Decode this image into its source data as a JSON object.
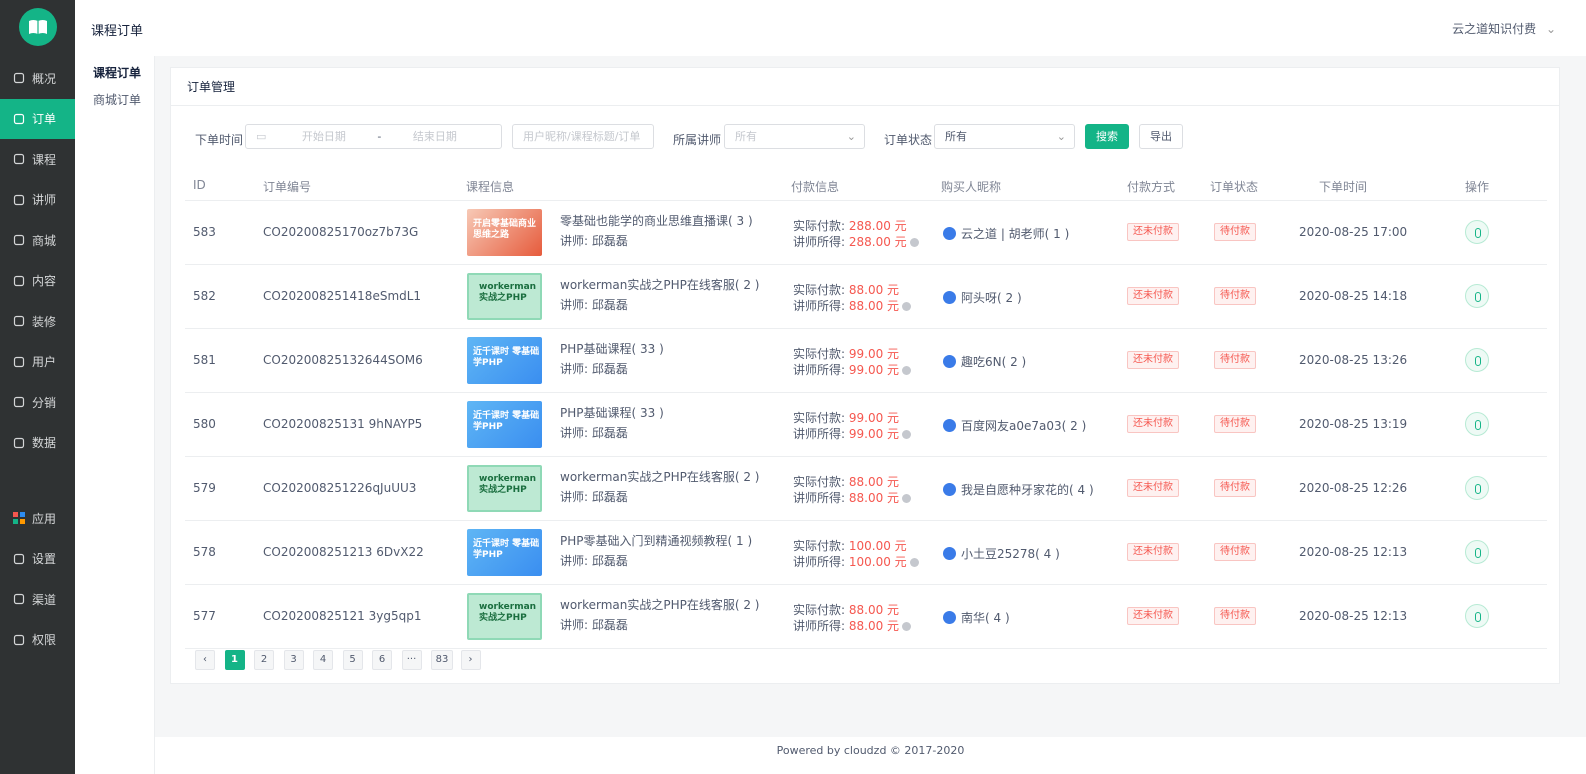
{
  "sidebar": {
    "items": [
      {
        "label": "概况",
        "icon": "home-icon"
      },
      {
        "label": "订单",
        "icon": "order-icon",
        "active": true
      },
      {
        "label": "课程",
        "icon": "course-icon"
      },
      {
        "label": "讲师",
        "icon": "teacher-icon"
      },
      {
        "label": "商城",
        "icon": "store-icon"
      },
      {
        "label": "内容",
        "icon": "content-icon"
      },
      {
        "label": "装修",
        "icon": "decorate-icon"
      },
      {
        "label": "用户",
        "icon": "user-icon"
      },
      {
        "label": "分销",
        "icon": "distribution-icon"
      },
      {
        "label": "数据",
        "icon": "data-icon"
      }
    ],
    "bottom_items": [
      {
        "label": "应用",
        "icon": "apps-icon"
      },
      {
        "label": "设置",
        "icon": "settings-icon"
      },
      {
        "label": "渠道",
        "icon": "channel-icon"
      },
      {
        "label": "权限",
        "icon": "permission-icon"
      }
    ]
  },
  "topbar": {
    "title": "课程订单",
    "user": "云之道知识付费"
  },
  "subnav": {
    "items": [
      "课程订单",
      "商城订单"
    ]
  },
  "card": {
    "title": "订单管理"
  },
  "filters": {
    "time_label": "下单时间",
    "start_placeholder": "开始日期",
    "range_sep": "-",
    "end_placeholder": "结束日期",
    "keyword_placeholder": "用户昵称/课程标题/订单",
    "teacher_label": "所属讲师",
    "teacher_value": "所有",
    "status_label": "订单状态",
    "status_value": "所有",
    "search_label": "搜索",
    "export_label": "导出"
  },
  "table": {
    "headers": [
      "ID",
      "订单编号",
      "课程信息",
      "付款信息",
      "购买人昵称",
      "付款方式",
      "订单状态",
      "下单时间",
      "操作"
    ],
    "paid_label": "实际付款:",
    "teacher_income_label": "讲师所得:",
    "teacher_prefix": "讲师:",
    "rows": [
      {
        "id": "583",
        "order_no": "CO20200825170oz7b73G",
        "course": "零基础也能学的商业思维直播课( 3 )",
        "teacher": "邱磊磊",
        "thumb": "t-red",
        "thumb_text": "开启零基础商业思维之路",
        "paid": "288.00 元",
        "income": "288.00 元",
        "buyer": "云之道 | 胡老师( 1 )",
        "pay_method": "还未付款",
        "status": "待付款",
        "time": "2020-08-25 17:00"
      },
      {
        "id": "582",
        "order_no": "CO202008251418eSmdL1",
        "course": "workerman实战之PHP在线客服( 2 )",
        "teacher": "邱磊磊",
        "thumb": "t-green",
        "thumb_text": "workerman 实战之PHP",
        "paid": "88.00 元",
        "income": "88.00 元",
        "buyer": "阿头呀( 2 )",
        "pay_method": "还未付款",
        "status": "待付款",
        "time": "2020-08-25 14:18"
      },
      {
        "id": "581",
        "order_no": "CO20200825132644SOM6",
        "course": "PHP基础课程( 33 )",
        "teacher": "邱磊磊",
        "thumb": "t-blue",
        "thumb_text": "近千课时 零基础学PHP",
        "paid": "99.00 元",
        "income": "99.00 元",
        "buyer": "趣吃6N( 2 )",
        "pay_method": "还未付款",
        "status": "待付款",
        "time": "2020-08-25 13:26"
      },
      {
        "id": "580",
        "order_no": "CO20200825131 9hNAYP5",
        "course": "PHP基础课程( 33 )",
        "teacher": "邱磊磊",
        "thumb": "t-blue",
        "thumb_text": "近千课时 零基础学PHP",
        "paid": "99.00 元",
        "income": "99.00 元",
        "buyer": "百度网友a0e7a03( 2 )",
        "pay_method": "还未付款",
        "status": "待付款",
        "time": "2020-08-25 13:19"
      },
      {
        "id": "579",
        "order_no": "CO202008251226qJuUU3",
        "course": "workerman实战之PHP在线客服( 2 )",
        "teacher": "邱磊磊",
        "thumb": "t-green",
        "thumb_text": "workerman 实战之PHP",
        "paid": "88.00 元",
        "income": "88.00 元",
        "buyer": "我是自愿种牙家花的( 4 )",
        "pay_method": "还未付款",
        "status": "待付款",
        "time": "2020-08-25 12:26"
      },
      {
        "id": "578",
        "order_no": "CO202008251213 6DvX22",
        "course": "PHP零基础入门到精通视频教程( 1 )",
        "teacher": "邱磊磊",
        "thumb": "t-blue",
        "thumb_text": "近千课时 零基础学PHP",
        "paid": "100.00 元",
        "income": "100.00 元",
        "buyer": "小土豆25278( 4 )",
        "pay_method": "还未付款",
        "status": "待付款",
        "time": "2020-08-25 12:13"
      },
      {
        "id": "577",
        "order_no": "CO20200825121 3yg5qp1",
        "course": "workerman实战之PHP在线客服( 2 )",
        "teacher": "邱磊磊",
        "thumb": "t-green",
        "thumb_text": "workerman 实战之PHP",
        "paid": "88.00 元",
        "income": "88.00 元",
        "buyer": "南华( 4 )",
        "pay_method": "还未付款",
        "status": "待付款",
        "time": "2020-08-25 12:13"
      }
    ]
  },
  "pagination": {
    "prev": "‹",
    "pages": [
      "1",
      "2",
      "3",
      "4",
      "5",
      "6",
      "···",
      "83"
    ],
    "current": "1",
    "next": "›"
  },
  "footer": {
    "text": "Powered by cloudzd © 2017-2020"
  },
  "colors": {
    "accent": "#14b487",
    "sidebar_bg": "#2f3233",
    "danger": "#f5574f"
  }
}
